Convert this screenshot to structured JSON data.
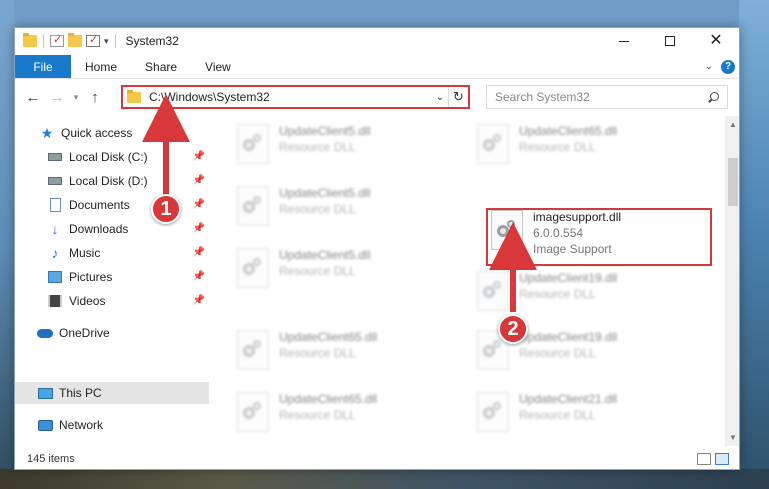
{
  "window": {
    "title": "System32",
    "controls": {
      "minimize": "—",
      "maximize": "□",
      "close": "✕"
    }
  },
  "ribbon": {
    "tabs": [
      "File",
      "Home",
      "Share",
      "View"
    ],
    "help": "?"
  },
  "address": {
    "path": "C:\\Windows\\System32",
    "search_placeholder": "Search System32"
  },
  "nav_pane": {
    "items": [
      {
        "label": "Quick access",
        "icon": "star-icon",
        "pinned": false
      },
      {
        "label": "Local Disk (C:)",
        "icon": "disk-icon",
        "pinned": true
      },
      {
        "label": "Local Disk (D:)",
        "icon": "disk-icon",
        "pinned": true
      },
      {
        "label": "Documents",
        "icon": "documents-icon",
        "pinned": true
      },
      {
        "label": "Downloads",
        "icon": "download-icon",
        "pinned": true
      },
      {
        "label": "Music",
        "icon": "music-icon",
        "pinned": true
      },
      {
        "label": "Pictures",
        "icon": "pictures-icon",
        "pinned": true
      },
      {
        "label": "Videos",
        "icon": "videos-icon",
        "pinned": true
      },
      {
        "label": "OneDrive",
        "icon": "onedrive-icon",
        "pinned": false
      },
      {
        "label": "This PC",
        "icon": "pc-icon",
        "pinned": false,
        "selected": true
      },
      {
        "label": "Network",
        "icon": "network-icon",
        "pinned": false
      }
    ]
  },
  "files": [
    {
      "name": "UpdateClient5.dll",
      "sub": "Resource DLL",
      "column": 0,
      "row": 0
    },
    {
      "name": "UpdateClient65.dll",
      "sub": "Resource DLL",
      "column": 1,
      "row": 0
    },
    {
      "name": "UpdateClient5.dll",
      "sub": "Resource DLL",
      "column": 0,
      "row": 1
    },
    {
      "name": "imagesupport.dll",
      "version": "6.0.0.554",
      "sub": "Image Support",
      "column": 1,
      "row": 1,
      "highlighted": true
    },
    {
      "name": "UpdateClient5.dll",
      "sub": "Resource DLL",
      "column": 0,
      "row": 2
    },
    {
      "name": "UpdateClient19.dll",
      "sub": "Resource DLL",
      "column": 1,
      "row": 2
    },
    {
      "name": "UpdateClient65.dll",
      "sub": "Resource DLL",
      "column": 0,
      "row": 3
    },
    {
      "name": "UpdateClient19.dll",
      "sub": "Resource DLL",
      "column": 1,
      "row": 3
    },
    {
      "name": "UpdateClient65.dll",
      "sub": "Resource DLL",
      "column": 0,
      "row": 4
    },
    {
      "name": "UpdateClient21.dll",
      "sub": "Resource DLL",
      "column": 1,
      "row": 4
    }
  ],
  "status": {
    "item_count": "145 items"
  },
  "annotations": {
    "step1": "1",
    "step2": "2",
    "color": "#d9383a"
  }
}
